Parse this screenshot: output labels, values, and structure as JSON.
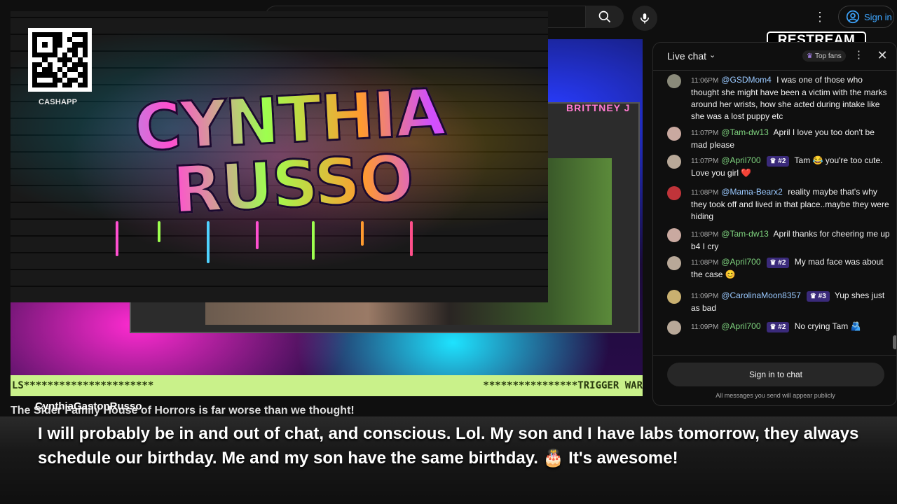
{
  "topbar": {
    "search_icon": "search-icon",
    "mic_icon": "microphone-icon",
    "menu_icon": "more-vertical-icon",
    "signin_label": "Sign in",
    "signin_icon": "user-circle-icon"
  },
  "overlay": {
    "graffiti_text": "CYNTHIA RUSSO",
    "cashapp_label": "CASHAPP",
    "nametag": "BRITTNEY J",
    "stripe_left": "LS**********************",
    "stripe_right": "****************TRIGGER WAR",
    "restream": "RESTREAM"
  },
  "video_title": "The Sider Family House of Horrors is far worse than we thought!",
  "channel_name": "CynthiaGastonRusso",
  "chat": {
    "title": "Live chat",
    "top_fans_label": "Top fans",
    "messages": [
      {
        "time": "11:06PM",
        "author": "@GSDMom4",
        "badge": "",
        "text": "I was one of those who thought she might have been a victim with the marks around her wrists, how she acted during intake like she was a lost puppy etc",
        "avatar_color": "#8a8a7a"
      },
      {
        "time": "11:07PM",
        "author": "@Tam-dw13",
        "badge": "",
        "text": "April I love you too don't be mad please",
        "avatar_color": "#c9a9a0"
      },
      {
        "time": "11:07PM",
        "author": "@April700",
        "badge": "#2",
        "text": "Tam 😂 you're too cute. Love you girl ❤️",
        "avatar_color": "#b8a898"
      },
      {
        "time": "11:08PM",
        "author": "@Mama-Bearx2",
        "badge": "",
        "text": "reality maybe that's why they took off and lived in that place..maybe they were hiding",
        "avatar_color": "#c0343a"
      },
      {
        "time": "11:08PM",
        "author": "@Tam-dw13",
        "badge": "",
        "text": "April thanks for cheering me up b4 I cry",
        "avatar_color": "#c9a9a0"
      },
      {
        "time": "11:08PM",
        "author": "@April700",
        "badge": "#2",
        "text": "My mad face was about the case 😊",
        "avatar_color": "#b8a898"
      },
      {
        "time": "11:09PM",
        "author": "@CarolinaMoon8357",
        "badge": "#3",
        "text": "Yup shes just as bad",
        "avatar_color": "#c9b070"
      },
      {
        "time": "11:09PM",
        "author": "@April700",
        "badge": "#2",
        "text": "No crying Tam 🫂",
        "avatar_color": "#b8a898"
      }
    ],
    "signin_label": "Sign in to chat",
    "public_note": "All messages you send will appear publicly"
  },
  "caption": "I will probably be in and out of chat, and conscious. Lol. My son and I have labs tomorrow, they always schedule our birthday. Me and my son have the same birthday. 🎂 It's awesome!"
}
